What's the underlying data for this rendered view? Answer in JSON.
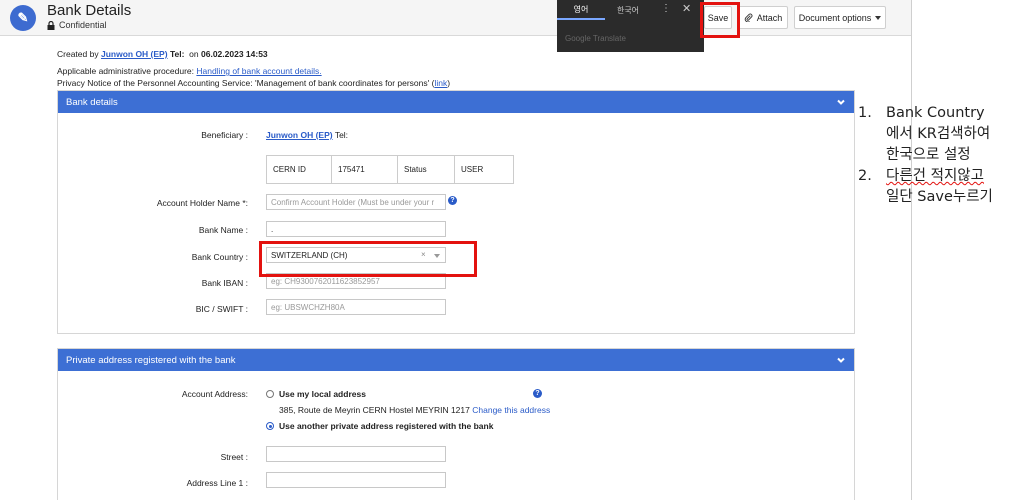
{
  "app": {
    "logo_text": "✎",
    "title": "Bank Details",
    "subtitle": "Confidential",
    "icons": {
      "logo": "document-logo-icon",
      "lock": "lock-icon"
    }
  },
  "toolbar": {
    "save_label": "Save",
    "attach_label": "Attach",
    "doc_options_label": "Document options"
  },
  "translate_popup": {
    "tab_source": "영어",
    "tab_target": "한국어",
    "more": "⋮",
    "close": "✕",
    "footer": "Google Translate"
  },
  "header_info": {
    "created_by_prefix": "Created by",
    "created_by_name": "Junwon OH (EP)",
    "created_by_tel": "Tel:",
    "created_on": "on",
    "created_date": "06.02.2023 14:53",
    "procedure_prefix": "Applicable administrative procedure:",
    "procedure_link": "Handling of bank account details.",
    "privacy_text": "Privacy Notice of the Personnel Accounting Service: 'Management of bank coordinates for persons' (",
    "privacy_link": "link",
    "privacy_suffix": ")"
  },
  "bank_section": {
    "title": "Bank details",
    "beneficiary_label": "Beneficiary :",
    "beneficiary_name": "Junwon OH (EP)",
    "beneficiary_tel": "Tel:",
    "cern_id_label": "CERN ID",
    "cern_id_value": "175471",
    "status_label": "Status",
    "status_value": "USER",
    "account_holder_label": "Account Holder Name *:",
    "account_holder_placeholder": "Confirm Account Holder (Must be under your r",
    "bank_name_label": "Bank Name :",
    "bank_name_value": ".",
    "bank_country_label": "Bank Country :",
    "bank_country_value": "SWITZERLAND (CH)",
    "bank_country_clear": "×",
    "bank_iban_label": "Bank IBAN :",
    "bank_iban_placeholder": "eg: CH9300762011623852957",
    "bic_label": "BIC / SWIFT :",
    "bic_placeholder": "eg: UBSWCHZH80A"
  },
  "address_section": {
    "title": "Private address registered with the bank",
    "account_address_label": "Account Address:",
    "option_local": "Use my local address",
    "local_address": "385, Route de Meyrin CERN Hostel MEYRIN 1217",
    "change_link": "Change this address",
    "option_other": "Use another private address registered with the bank",
    "street_label": "Street :",
    "address_line1_label": "Address Line 1 :"
  },
  "notes": {
    "items": [
      {
        "num": "1.",
        "lines": [
          "Bank Country",
          "에서 KR검색하여",
          "한국으로 설정"
        ]
      },
      {
        "num": "2.",
        "lines": [
          "다른건 적지않고",
          "일단 Save누르기"
        ]
      }
    ]
  },
  "colors": {
    "section_header": "#3d6fd4",
    "link": "#2a5bc8",
    "highlight": "#e3120f"
  }
}
